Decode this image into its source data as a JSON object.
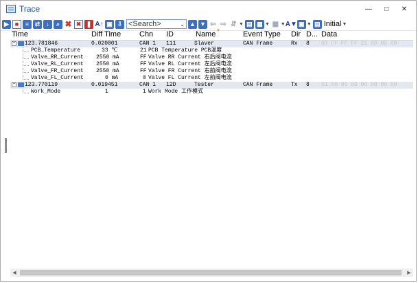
{
  "window": {
    "title": "Trace"
  },
  "toolbar": {
    "search_placeholder": "<Search>",
    "initial_label": "Initial"
  },
  "columns": {
    "time": "Time",
    "diff": "Diff Time",
    "chn": "Chn",
    "id": "ID",
    "name": "Name",
    "event_type": "Event Type",
    "dir": "Dir",
    "dlc": "D...",
    "data": "Data"
  },
  "rows": [
    {
      "time": "123.781846",
      "diff": "0.020001",
      "chn": "CAN 1",
      "id": "111",
      "name": "Slaver",
      "event_type": "CAN Frame",
      "dir": "Rx",
      "dlc": "8",
      "data": "00 FF FF FF 21 00 00 00"
    },
    {
      "time": "123.770119",
      "diff": "0.019451",
      "chn": "CAN 1",
      "id": "12D",
      "name": "Tester",
      "event_type": "CAN Frame",
      "dir": "Tx",
      "dlc": "8",
      "data": "01 00 00 00 00 00 00 00"
    }
  ],
  "signals": [
    {
      "name": "PCB_Temperature",
      "value": "33 ℃",
      "raw": "21",
      "desc": "PCB Temperature PCB温度"
    },
    {
      "name": "Valve_RR_Current",
      "value": "2550 mA",
      "raw": "FF",
      "desc": "Valve RR Current 右后阀电流"
    },
    {
      "name": "Valve_RL_Current",
      "value": "2550 mA",
      "raw": "FF",
      "desc": "Valve RL Current 左后阀电流"
    },
    {
      "name": "Valve_FR_Current",
      "value": "2550 mA",
      "raw": "FF",
      "desc": "Valve FR Current 右前阀电流"
    },
    {
      "name": "Valve_FL_Current",
      "value": "0 mA",
      "raw": "0",
      "desc": "Valve FL Current 左前阀电流"
    },
    {
      "name": "Work_Mode",
      "value": "1",
      "raw": "1",
      "desc": "Work Mode 工作模式"
    }
  ],
  "colors": {
    "parent_row_bg": "#e3e8f0",
    "title_text": "#1a4f9c",
    "data_grey": "#c3c6cc"
  }
}
